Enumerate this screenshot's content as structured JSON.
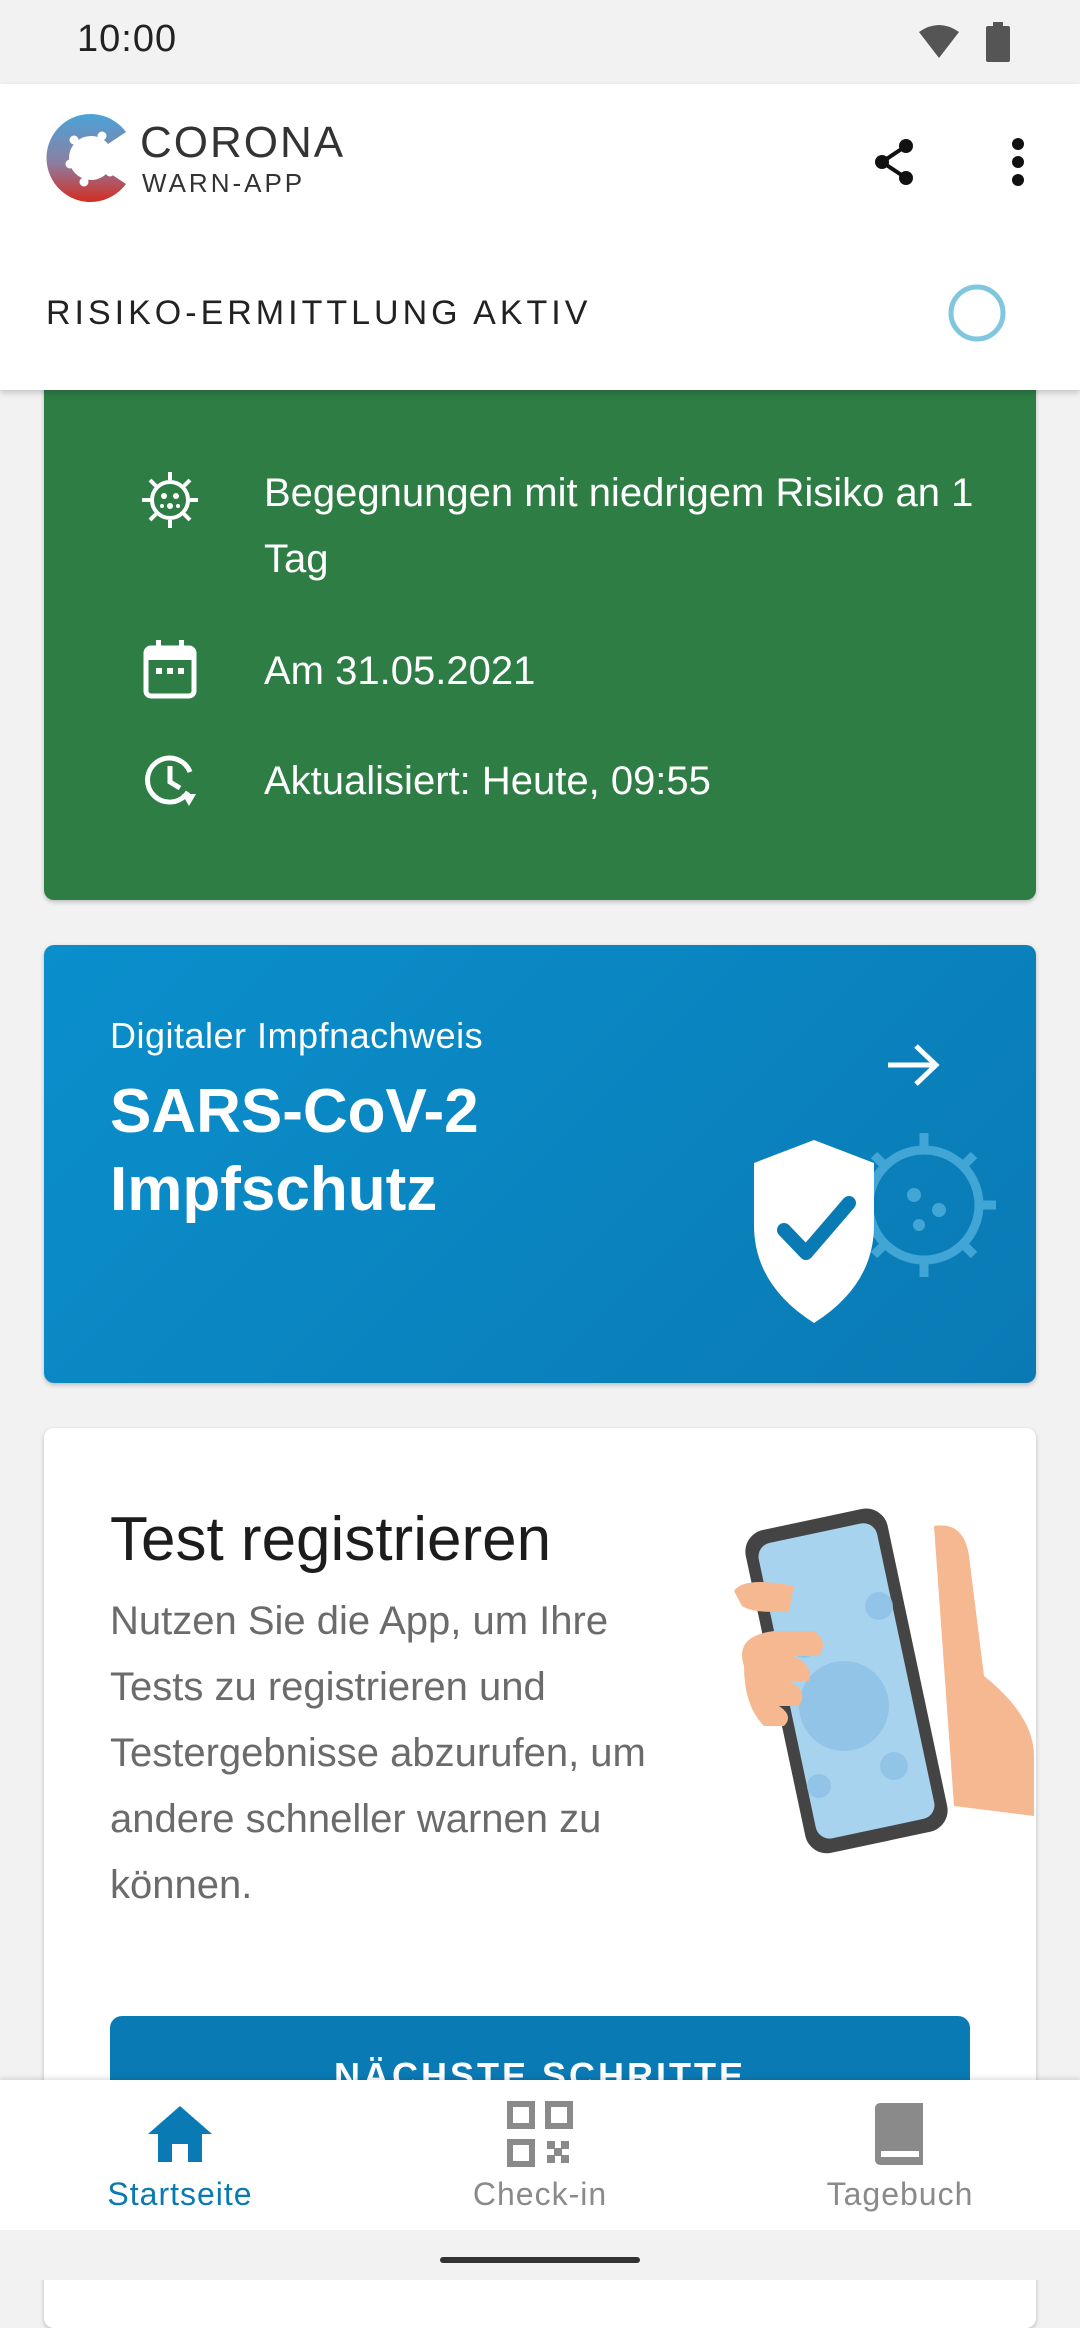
{
  "status_bar": {
    "time": "10:00"
  },
  "app_bar": {
    "brand_title": "CORONA",
    "brand_subtitle": "WARN-APP",
    "risk_status_label": "RISIKO-ERMITTLUNG AKTIV"
  },
  "risk_card": {
    "rows": [
      {
        "icon": "virus-icon",
        "text": "Begegnungen mit niedrigem Risiko an 1 Tag"
      },
      {
        "icon": "calendar-icon",
        "text": "Am 31.05.2021"
      },
      {
        "icon": "history-clock-icon",
        "text": "Aktualisiert: Heute, 09:55"
      }
    ]
  },
  "vaccination_card": {
    "subtitle": "Digitaler Impfnachweis",
    "title": "SARS-CoV-2 Impfschutz"
  },
  "test_card": {
    "title": "Test registrieren",
    "body": "Nutzen Sie die App, um Ihre Tests zu registrieren und Testergebnisse abzurufen, um andere schneller warnen zu können.",
    "button_label": "NÄCHSTE SCHRITTE"
  },
  "bottom_nav": {
    "items": [
      {
        "label": "Startseite",
        "icon": "home-icon",
        "active": true
      },
      {
        "label": "Check-in",
        "icon": "qr-code-icon",
        "active": false
      },
      {
        "label": "Tagebuch",
        "icon": "book-icon",
        "active": false
      }
    ]
  },
  "colors": {
    "risk_green": "#2e7d45",
    "primary_blue": "#0a7ab4",
    "nav_active": "#0a7ab4",
    "nav_inactive": "#8a8a8a"
  }
}
